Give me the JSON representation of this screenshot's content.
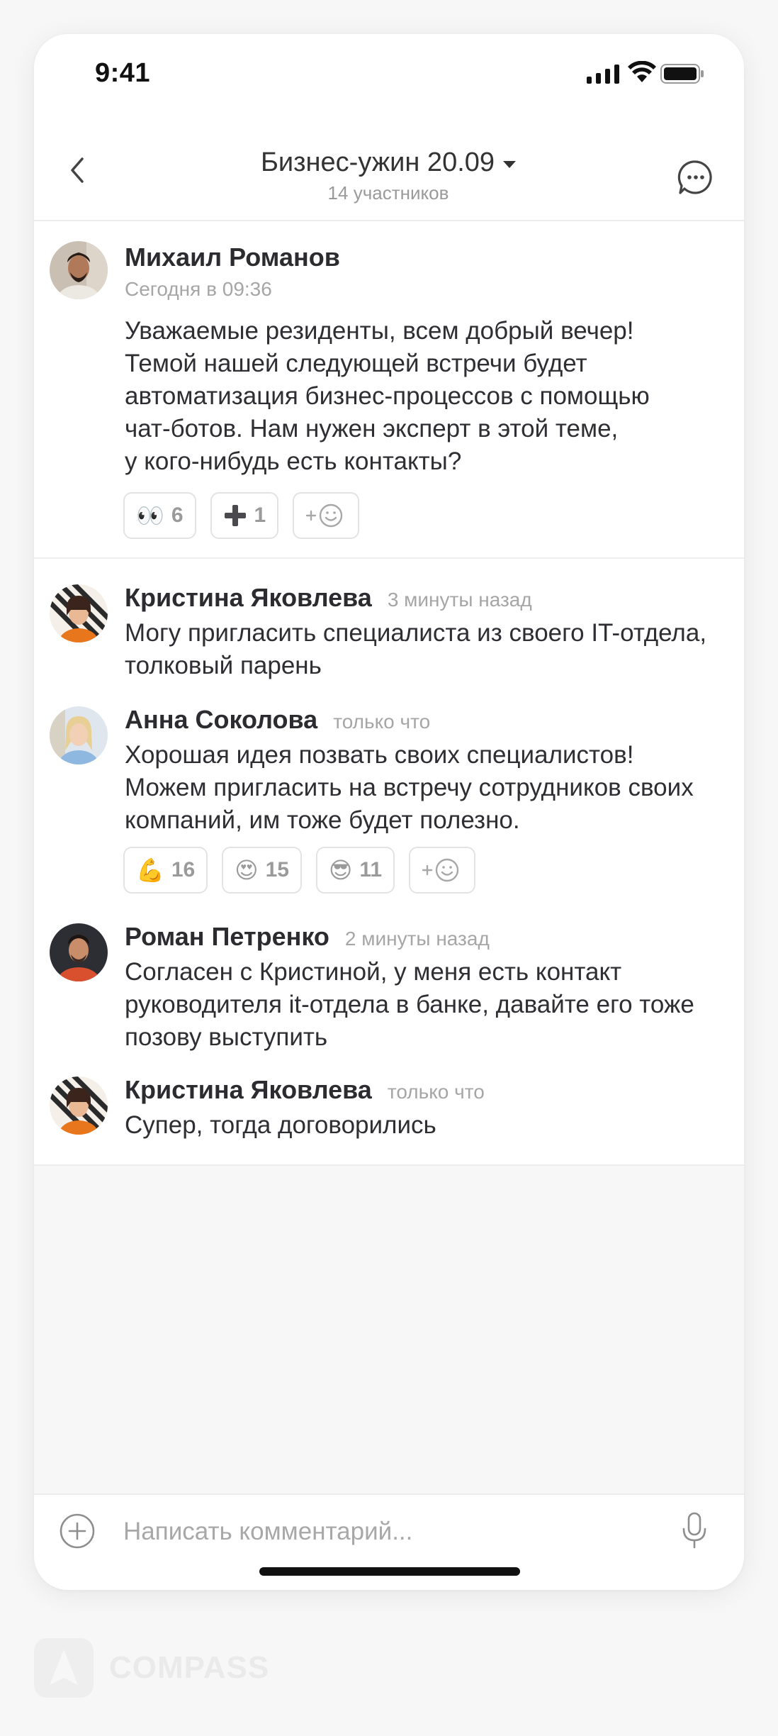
{
  "status_bar": {
    "time": "9:41"
  },
  "header": {
    "title": "Бизнес-ужин 20.09",
    "subtitle": "14 участников"
  },
  "post": {
    "author": "Михаил Романов",
    "timestamp": "Сегодня в 09:36",
    "text_lines": [
      "Уважаемые резиденты, всем добрый вечер!",
      "Темой нашей следующей встречи будет",
      "автоматизация бизнес-процессов с помощью",
      "чат-ботов. Нам нужен эксперт в этой теме,",
      "у кого-нибудь есть контакты?"
    ],
    "reactions": [
      {
        "emoji": "👀",
        "count": "6"
      },
      {
        "emoji": "➕",
        "count": "1"
      }
    ],
    "add_reaction_label": "+☺"
  },
  "comments": [
    {
      "author": "Кристина Яковлева",
      "time": "3 минуты назад",
      "text": "Могу пригласить специалиста из своего IT-отдела, толковый парень"
    },
    {
      "author": "Анна Соколова",
      "time": "только что",
      "text": "Хорошая идея позвать своих специалистов! Можем пригласить на встречу сотрудников своих компаний, им тоже будет полезно.",
      "reactions": [
        {
          "emoji": "💪",
          "count": "16"
        },
        {
          "emoji": "😍",
          "count": "15"
        },
        {
          "emoji": "😎",
          "count": "11"
        }
      ],
      "add_reaction_label": "+☺"
    },
    {
      "author": "Роман Петренко",
      "time": "2 минуты назад",
      "text": "Согласен с Кристиной, у меня есть контакт руководителя it-отдела в банке, давайте его тоже позову выступить"
    },
    {
      "author": "Кристина Яковлева",
      "time": "только что",
      "text": "Супер, тогда договорились"
    }
  ],
  "composer": {
    "placeholder": "Написать комментарий..."
  },
  "branding": {
    "logo_text": "COMPASS"
  },
  "colors": {
    "accent_dark": "#2f2f33",
    "muted": "#a6a6a6",
    "background": "#f7f7f7"
  }
}
